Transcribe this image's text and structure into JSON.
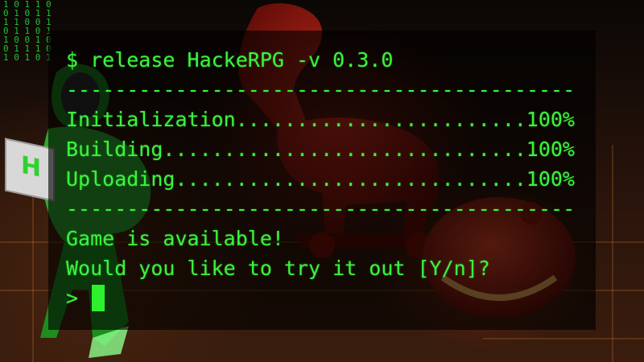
{
  "terminal": {
    "command": "$ release HackeRPG -v 0.3.0",
    "divider": "-----------------------------------------------------",
    "steps": [
      {
        "label": "Initialization",
        "dots": "..................................",
        "percent": "100%"
      },
      {
        "label": "Building",
        "dots": "........................................",
        "percent": "100%"
      },
      {
        "label": "Uploading",
        "dots": ".......................................",
        "percent": "100%"
      }
    ],
    "status_message": "Game is available!",
    "question": "Would you like to try it out [Y/n]?",
    "prompt_symbol": ">"
  },
  "background": {
    "code_rain": "1 0 1 1 0 1\n0 1 0 1 1 0\n1 1 0 0 1 0\n0 1 1 0 1 1\n1 0 0 1 0 1\n0 1 1 1 0 0\n1 0 1 0 1 1",
    "laptop_letter": "H"
  },
  "colors": {
    "terminal_text": "#39f53d",
    "terminal_bg": "rgba(0,0,0,0.62)",
    "horse_red": "#b3190f",
    "hacker_green": "#2fa52f"
  }
}
